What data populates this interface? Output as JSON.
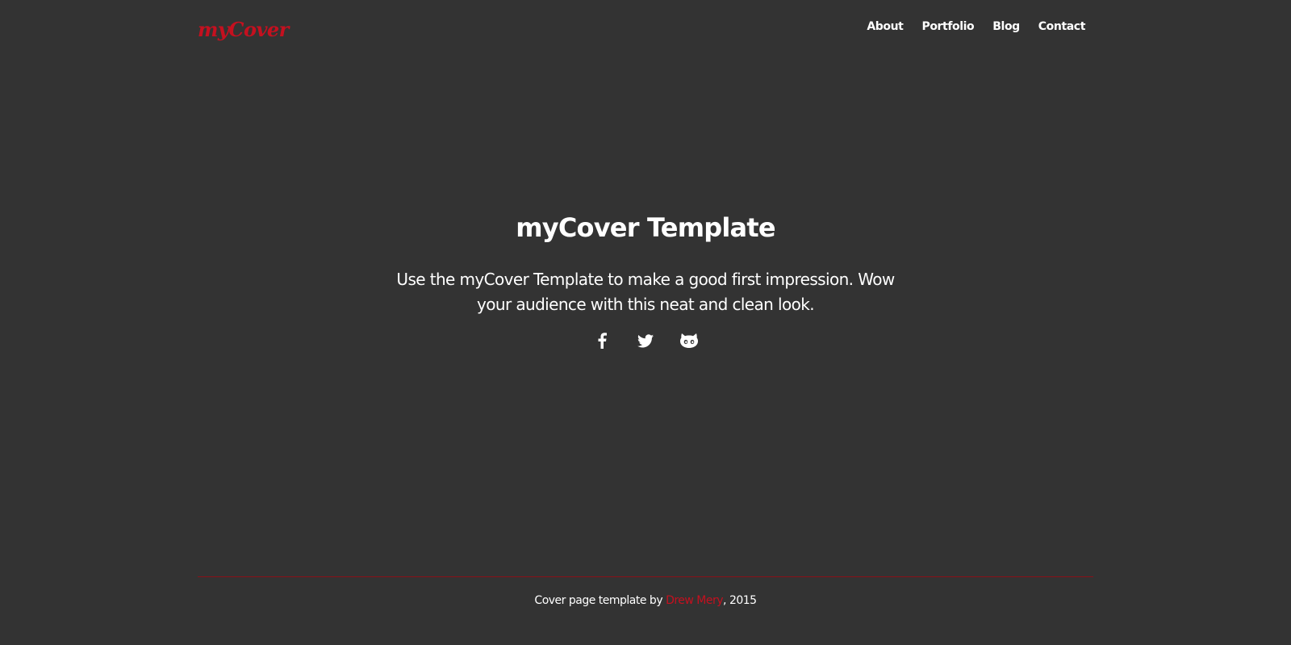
{
  "colors": {
    "background": "#333333",
    "accent": "#c5101f",
    "text": "#ffffff",
    "footer_rule": "#8a1018"
  },
  "header": {
    "brand": "myCover",
    "nav": [
      {
        "label": "About"
      },
      {
        "label": "Portfolio"
      },
      {
        "label": "Blog"
      },
      {
        "label": "Contact"
      }
    ]
  },
  "hero": {
    "title": "myCover Template",
    "lead": "Use the myCover Template to make a good first impression. Wow your audience with this neat and clean look.",
    "social_icons": [
      "facebook-icon",
      "twitter-icon",
      "github-icon"
    ]
  },
  "footer": {
    "prefix": "Cover page template by ",
    "author": "Drew Mery",
    "suffix": ", 2015"
  }
}
